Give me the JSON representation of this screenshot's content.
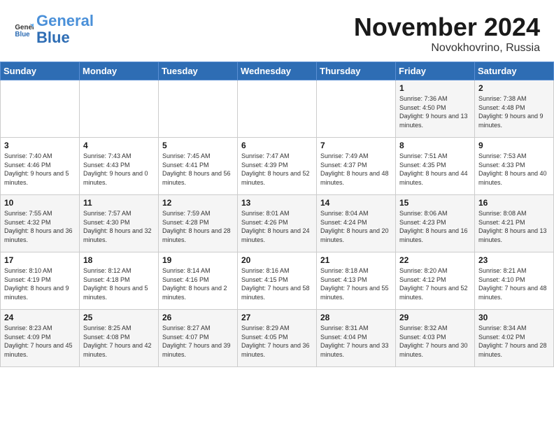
{
  "header": {
    "logo_text_general": "General",
    "logo_text_blue": "Blue",
    "month": "November 2024",
    "location": "Novokhovrino, Russia"
  },
  "days_of_week": [
    "Sunday",
    "Monday",
    "Tuesday",
    "Wednesday",
    "Thursday",
    "Friday",
    "Saturday"
  ],
  "weeks": [
    [
      {
        "day": "",
        "info": ""
      },
      {
        "day": "",
        "info": ""
      },
      {
        "day": "",
        "info": ""
      },
      {
        "day": "",
        "info": ""
      },
      {
        "day": "",
        "info": ""
      },
      {
        "day": "1",
        "info": "Sunrise: 7:36 AM\nSunset: 4:50 PM\nDaylight: 9 hours and 13 minutes."
      },
      {
        "day": "2",
        "info": "Sunrise: 7:38 AM\nSunset: 4:48 PM\nDaylight: 9 hours and 9 minutes."
      }
    ],
    [
      {
        "day": "3",
        "info": "Sunrise: 7:40 AM\nSunset: 4:46 PM\nDaylight: 9 hours and 5 minutes."
      },
      {
        "day": "4",
        "info": "Sunrise: 7:43 AM\nSunset: 4:43 PM\nDaylight: 9 hours and 0 minutes."
      },
      {
        "day": "5",
        "info": "Sunrise: 7:45 AM\nSunset: 4:41 PM\nDaylight: 8 hours and 56 minutes."
      },
      {
        "day": "6",
        "info": "Sunrise: 7:47 AM\nSunset: 4:39 PM\nDaylight: 8 hours and 52 minutes."
      },
      {
        "day": "7",
        "info": "Sunrise: 7:49 AM\nSunset: 4:37 PM\nDaylight: 8 hours and 48 minutes."
      },
      {
        "day": "8",
        "info": "Sunrise: 7:51 AM\nSunset: 4:35 PM\nDaylight: 8 hours and 44 minutes."
      },
      {
        "day": "9",
        "info": "Sunrise: 7:53 AM\nSunset: 4:33 PM\nDaylight: 8 hours and 40 minutes."
      }
    ],
    [
      {
        "day": "10",
        "info": "Sunrise: 7:55 AM\nSunset: 4:32 PM\nDaylight: 8 hours and 36 minutes."
      },
      {
        "day": "11",
        "info": "Sunrise: 7:57 AM\nSunset: 4:30 PM\nDaylight: 8 hours and 32 minutes."
      },
      {
        "day": "12",
        "info": "Sunrise: 7:59 AM\nSunset: 4:28 PM\nDaylight: 8 hours and 28 minutes."
      },
      {
        "day": "13",
        "info": "Sunrise: 8:01 AM\nSunset: 4:26 PM\nDaylight: 8 hours and 24 minutes."
      },
      {
        "day": "14",
        "info": "Sunrise: 8:04 AM\nSunset: 4:24 PM\nDaylight: 8 hours and 20 minutes."
      },
      {
        "day": "15",
        "info": "Sunrise: 8:06 AM\nSunset: 4:23 PM\nDaylight: 8 hours and 16 minutes."
      },
      {
        "day": "16",
        "info": "Sunrise: 8:08 AM\nSunset: 4:21 PM\nDaylight: 8 hours and 13 minutes."
      }
    ],
    [
      {
        "day": "17",
        "info": "Sunrise: 8:10 AM\nSunset: 4:19 PM\nDaylight: 8 hours and 9 minutes."
      },
      {
        "day": "18",
        "info": "Sunrise: 8:12 AM\nSunset: 4:18 PM\nDaylight: 8 hours and 5 minutes."
      },
      {
        "day": "19",
        "info": "Sunrise: 8:14 AM\nSunset: 4:16 PM\nDaylight: 8 hours and 2 minutes."
      },
      {
        "day": "20",
        "info": "Sunrise: 8:16 AM\nSunset: 4:15 PM\nDaylight: 7 hours and 58 minutes."
      },
      {
        "day": "21",
        "info": "Sunrise: 8:18 AM\nSunset: 4:13 PM\nDaylight: 7 hours and 55 minutes."
      },
      {
        "day": "22",
        "info": "Sunrise: 8:20 AM\nSunset: 4:12 PM\nDaylight: 7 hours and 52 minutes."
      },
      {
        "day": "23",
        "info": "Sunrise: 8:21 AM\nSunset: 4:10 PM\nDaylight: 7 hours and 48 minutes."
      }
    ],
    [
      {
        "day": "24",
        "info": "Sunrise: 8:23 AM\nSunset: 4:09 PM\nDaylight: 7 hours and 45 minutes."
      },
      {
        "day": "25",
        "info": "Sunrise: 8:25 AM\nSunset: 4:08 PM\nDaylight: 7 hours and 42 minutes."
      },
      {
        "day": "26",
        "info": "Sunrise: 8:27 AM\nSunset: 4:07 PM\nDaylight: 7 hours and 39 minutes."
      },
      {
        "day": "27",
        "info": "Sunrise: 8:29 AM\nSunset: 4:05 PM\nDaylight: 7 hours and 36 minutes."
      },
      {
        "day": "28",
        "info": "Sunrise: 8:31 AM\nSunset: 4:04 PM\nDaylight: 7 hours and 33 minutes."
      },
      {
        "day": "29",
        "info": "Sunrise: 8:32 AM\nSunset: 4:03 PM\nDaylight: 7 hours and 30 minutes."
      },
      {
        "day": "30",
        "info": "Sunrise: 8:34 AM\nSunset: 4:02 PM\nDaylight: 7 hours and 28 minutes."
      }
    ]
  ]
}
